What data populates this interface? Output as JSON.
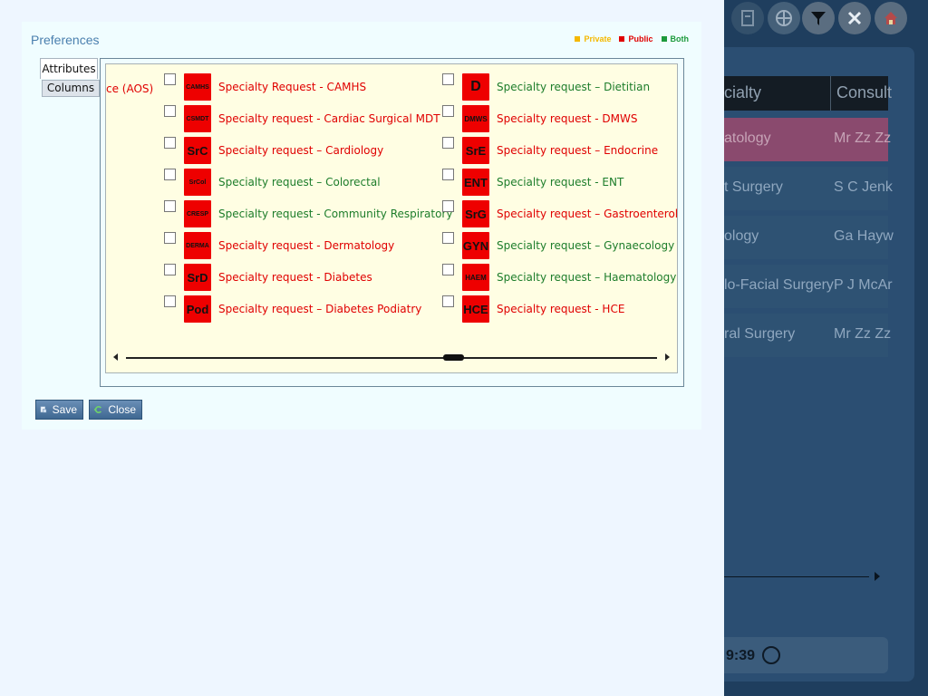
{
  "dialog": {
    "title": "Preferences",
    "legend": [
      {
        "label": "Private",
        "color": "#f5b800"
      },
      {
        "label": "Public",
        "color": "#e00000"
      },
      {
        "label": "Both",
        "color": "#1d9a3c"
      }
    ],
    "tabs": {
      "attributes": "Attributes",
      "columns": "Columns"
    },
    "partial_label": "ce (AOS)",
    "items_col1": [
      {
        "badge": "CAMHS",
        "label": "Specialty Request - CAMHS",
        "type": "public"
      },
      {
        "badge": "CSMDT",
        "label": "Specialty request - Cardiac Surgical MDT",
        "type": "public"
      },
      {
        "badge": "SrC",
        "label": "Specialty request – Cardiology",
        "type": "public"
      },
      {
        "badge": "SrCol",
        "label": "Specialty request – Colorectal",
        "type": "both"
      },
      {
        "badge": "CRESP",
        "label": "Specialty request - Community Respiratory",
        "type": "both"
      },
      {
        "badge": "DERMA",
        "label": "Specialty request - Dermatology",
        "type": "public"
      },
      {
        "badge": "SrD",
        "label": "Specialty request - Diabetes",
        "type": "public"
      },
      {
        "badge": "Pod",
        "label": "Specialty request – Diabetes Podiatry",
        "type": "public"
      }
    ],
    "items_col2": [
      {
        "badge": "D",
        "label": "Specialty request – Dietitian",
        "type": "both"
      },
      {
        "badge": "DMWS",
        "label": "Specialty request - DMWS",
        "type": "public"
      },
      {
        "badge": "SrE",
        "label": "Specialty request – Endocrine",
        "type": "public"
      },
      {
        "badge": "ENT",
        "label": "Specialty request - ENT",
        "type": "both"
      },
      {
        "badge": "SrG",
        "label": "Specialty request – Gastroenterology",
        "type": "public"
      },
      {
        "badge": "GYN",
        "label": "Specialty request – Gynaecology",
        "type": "both"
      },
      {
        "badge": "HAEM",
        "label": "Specialty request – Haematology",
        "type": "both"
      },
      {
        "badge": "HCE",
        "label": "Specialty request - HCE",
        "type": "public"
      }
    ],
    "buttons": {
      "save": "Save",
      "close": "Close"
    }
  },
  "background": {
    "grid_header": [
      "cialty",
      "Consult"
    ],
    "rows": [
      {
        "specialty": "atology",
        "consultant": "Mr Zz Zz",
        "highlight": true
      },
      {
        "specialty": "t Surgery",
        "consultant": "S C Jenk",
        "highlight": false
      },
      {
        "specialty": "ology",
        "consultant": "Ga Hayw",
        "highlight": false
      },
      {
        "specialty": "lo-Facial Surgery",
        "consultant": "P J McAr",
        "highlight": false
      },
      {
        "specialty": "ral Surgery",
        "consultant": "Mr Zz Zz",
        "highlight": false
      }
    ],
    "footer_time": "9:39"
  }
}
